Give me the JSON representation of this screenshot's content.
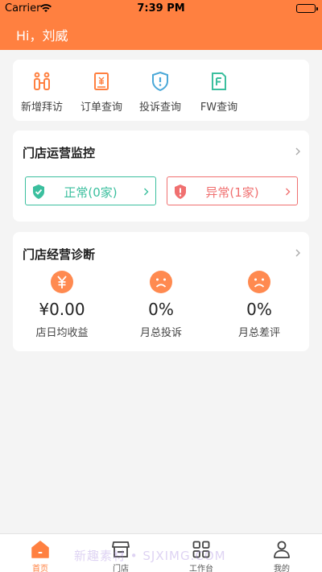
{
  "status_bar": {
    "carrier": "Carrier",
    "time": "7:39 PM"
  },
  "header": {
    "greeting": "Hi，刘威"
  },
  "quick_actions": [
    {
      "label": "新增拜访",
      "icon": "visit-icon"
    },
    {
      "label": "订单查询",
      "icon": "order-icon"
    },
    {
      "label": "投诉查询",
      "icon": "complaint-icon"
    },
    {
      "label": "FW查询",
      "icon": "fw-icon"
    }
  ],
  "monitor": {
    "title": "门店运营监控",
    "normal_label": "正常(0家)",
    "abnormal_label": "异常(1家)"
  },
  "diagnosis": {
    "title": "门店经营诊断",
    "metrics": [
      {
        "value": "¥0.00",
        "label": "店日均收益",
        "icon": "yuan-icon"
      },
      {
        "value": "0%",
        "label": "月总投诉",
        "icon": "sad-face-icon"
      },
      {
        "value": "0%",
        "label": "月总差评",
        "icon": "sad-face-icon"
      }
    ]
  },
  "tabs": [
    {
      "label": "首页",
      "icon": "home-icon",
      "active": true
    },
    {
      "label": "门店",
      "icon": "store-icon",
      "active": false
    },
    {
      "label": "工作台",
      "icon": "grid-icon",
      "active": false
    },
    {
      "label": "我的",
      "icon": "user-icon",
      "active": false
    }
  ],
  "watermark": "新趣素材 • SJXIMG.COM",
  "colors": {
    "accent": "#ff8040",
    "normal": "#3bbf9e",
    "abnormal": "#f07070",
    "icon_blue": "#4aa8d8",
    "icon_teal": "#3bbf9e"
  }
}
